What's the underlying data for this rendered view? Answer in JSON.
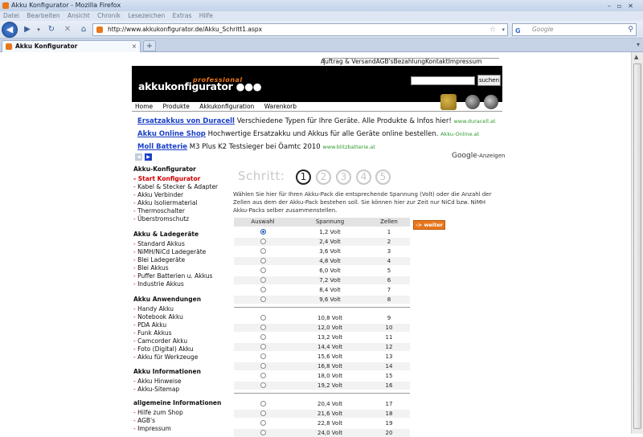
{
  "window": {
    "title": "Akku Konfigurator - Mozilla Firefox"
  },
  "menu": [
    "Datei",
    "Bearbeiten",
    "Ansicht",
    "Chronik",
    "Lesezeichen",
    "Extras",
    "Hilfe"
  ],
  "browser": {
    "url": "http://www.akkukonfigurator.de/Akku_Schritt1.aspx",
    "search_placeholder": "Google",
    "tab_title": "Akku Konfigurator"
  },
  "site": {
    "top_links": [
      "Auftrag & Versand",
      "AGB's",
      "Bezahlung",
      "Kontakt",
      "Impressum"
    ],
    "logo_pro": "professional",
    "logo": "akkukonfigurator",
    "search_button": "suchen",
    "nav": [
      "Home",
      "Produkte",
      "Akkukonfiguration",
      "Warenkorb"
    ]
  },
  "ads": [
    {
      "title": "Ersatzakkus von Duracell",
      "text": "Verschiedene Typen für Ihre Geräte. Alle Produkte & Infos hier!",
      "url": "www.duracell.at"
    },
    {
      "title": "Akku Online Shop",
      "text": "Hochwertige Ersatzakku und Akkus für alle Geräte online bestellen.",
      "url": "Akku-Online.at"
    },
    {
      "title": "Moll Batterie",
      "text": "M3 Plus K2 Testsieger bei Öamtc 2010",
      "url": "www.blitzbatterie.at"
    }
  ],
  "google_ads": {
    "brand": "Google",
    "label": "-Anzeigen"
  },
  "sidebar": [
    {
      "title": "Akku-Konfigurator",
      "items": [
        "Start Konfigurator",
        "Kabel & Stecker & Adapter",
        "Akku Verbinder",
        "Akku Isoliermaterial",
        "Thermoschalter",
        "Überstromschutz"
      ]
    },
    {
      "title": "Akku & Ladegeräte",
      "items": [
        "Standard Akkus",
        "NiMH/NiCd Ladegeräte",
        "Blei Ladegeräte",
        "Blei Akkus",
        "Puffer Batterien u. Akkus",
        "Industrie Akkus"
      ]
    },
    {
      "title": "Akku Anwendungen",
      "items": [
        "Handy Akku",
        "Notebook Akku",
        "PDA Akku",
        "Funk Akkus",
        "Camcorder Akku",
        "Foto (Digital) Akku",
        "Akku für Werkzeuge"
      ]
    },
    {
      "title": "Akku Informationen",
      "items": [
        "Akku Hinweise",
        "Akku-Sitemap"
      ]
    },
    {
      "title": "allgemeine Informationen",
      "items": [
        "Hilfe zum Shop",
        "AGB's",
        "Impressum"
      ]
    }
  ],
  "steps": {
    "label": "Schritt:",
    "numbers": [
      "1",
      "2",
      "3",
      "4",
      "5"
    ],
    "active": 1
  },
  "intro": "Wählen Sie hier für Ihren Akku-Pack die entsprechende Spannung (Volt) oder die Anzahl der Zellen aus dem der Akku-Pack bestehen soll. Sie können hier zur Zeit nur NiCd bzw. NiMH Akku-Packs selber zusammenstellen.",
  "table": {
    "headers": [
      "Auswahl",
      "Spannung",
      "Zellen"
    ],
    "rows": [
      {
        "volt": "1,2 Volt",
        "cells": "1",
        "selected": true
      },
      {
        "volt": "2,4 Volt",
        "cells": "2"
      },
      {
        "volt": "3,6 Volt",
        "cells": "3"
      },
      {
        "volt": "4,8 Volt",
        "cells": "4"
      },
      {
        "volt": "6,0 Volt",
        "cells": "5"
      },
      {
        "volt": "7,2 Volt",
        "cells": "6"
      },
      {
        "volt": "8,4 Volt",
        "cells": "7"
      },
      {
        "volt": "9,6 Volt",
        "cells": "8"
      },
      {
        "volt": "10,8 Volt",
        "cells": "9"
      },
      {
        "volt": "12,0 Volt",
        "cells": "10"
      },
      {
        "volt": "13,2 Volt",
        "cells": "11"
      },
      {
        "volt": "14,4 Volt",
        "cells": "12"
      },
      {
        "volt": "15,6 Volt",
        "cells": "13"
      },
      {
        "volt": "16,8 Volt",
        "cells": "14"
      },
      {
        "volt": "18,0 Volt",
        "cells": "15"
      },
      {
        "volt": "19,2 Volt",
        "cells": "16"
      },
      {
        "volt": "20,4 Volt",
        "cells": "17"
      },
      {
        "volt": "21,6 Volt",
        "cells": "18"
      },
      {
        "volt": "22,8 Volt",
        "cells": "19"
      },
      {
        "volt": "24,0 Volt",
        "cells": "20"
      }
    ]
  },
  "weiter_button": "-> weiter"
}
